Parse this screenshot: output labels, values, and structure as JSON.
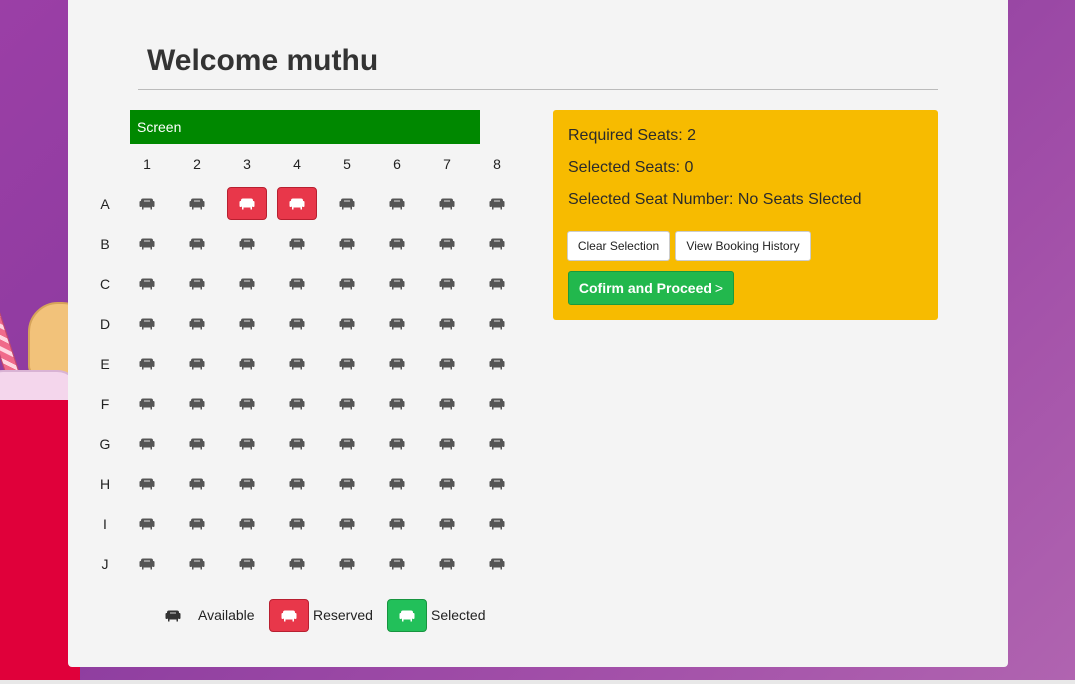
{
  "header": {
    "welcome": "Welcome muthu"
  },
  "screen": {
    "label": "Screen"
  },
  "columns": [
    "1",
    "2",
    "3",
    "4",
    "5",
    "6",
    "7",
    "8"
  ],
  "rows": [
    "A",
    "B",
    "C",
    "D",
    "E",
    "F",
    "G",
    "H",
    "I",
    "J"
  ],
  "reserved_seats": [
    "A3",
    "A4"
  ],
  "selected_seats": [],
  "legend": {
    "available": "Available",
    "reserved": "Reserved",
    "selected": "Selected"
  },
  "info": {
    "required": "Required Seats: 2",
    "selected_count": "Selected Seats: 0",
    "selected_numbers": "Selected Seat Number: No Seats Slected"
  },
  "buttons": {
    "clear": "Clear Selection",
    "history": "View Booking History",
    "proceed": "Cofirm and Proceed",
    "proceed_chevron": ">"
  },
  "icons": {
    "seat": "seat-icon"
  },
  "colors": {
    "screen": "#008800",
    "reserved": "#e8374a",
    "selected": "#22c05a",
    "info_box": "#f7bb00",
    "proceed": "#22b84d"
  }
}
